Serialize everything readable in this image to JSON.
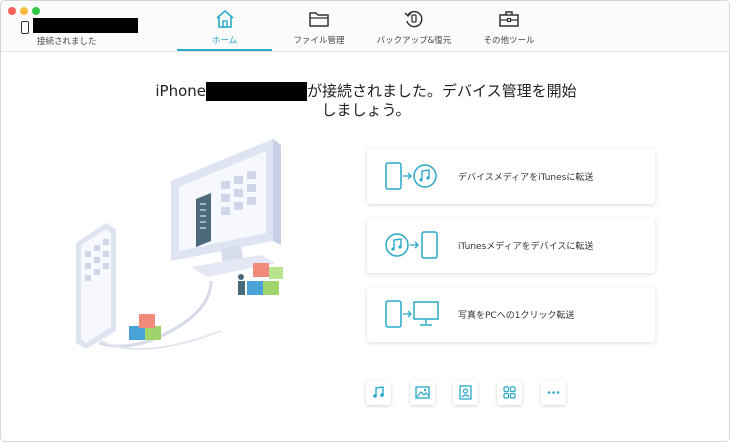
{
  "header": {
    "device_status": "接続されました"
  },
  "tabs": [
    {
      "label": "ホーム",
      "icon": "home-icon",
      "active": true
    },
    {
      "label": "ファイル管理",
      "icon": "folder-icon",
      "active": false
    },
    {
      "label": "バックアップ&復元",
      "icon": "restore-icon",
      "active": false
    },
    {
      "label": "その他ツール",
      "icon": "toolbox-icon",
      "active": false
    }
  ],
  "main": {
    "headline_prefix": "iPhone",
    "headline_suffix": "が接続されました。デバイス管理を開始",
    "headline_line2": "しましょう。"
  },
  "actions": [
    {
      "label": "デバイスメディアをiTunesに転送",
      "icon": "phone-to-itunes-icon"
    },
    {
      "label": "iTunesメディアをデバイスに転送",
      "icon": "itunes-to-phone-icon"
    },
    {
      "label": "写真をPCへの1クリック転送",
      "icon": "phone-to-pc-icon"
    }
  ],
  "quick_buttons": [
    {
      "icon": "music-icon"
    },
    {
      "icon": "photo-icon"
    },
    {
      "icon": "contacts-icon"
    },
    {
      "icon": "apps-icon"
    },
    {
      "icon": "more-icon"
    }
  ],
  "colors": {
    "accent": "#2aa8c8",
    "text": "#333333"
  }
}
